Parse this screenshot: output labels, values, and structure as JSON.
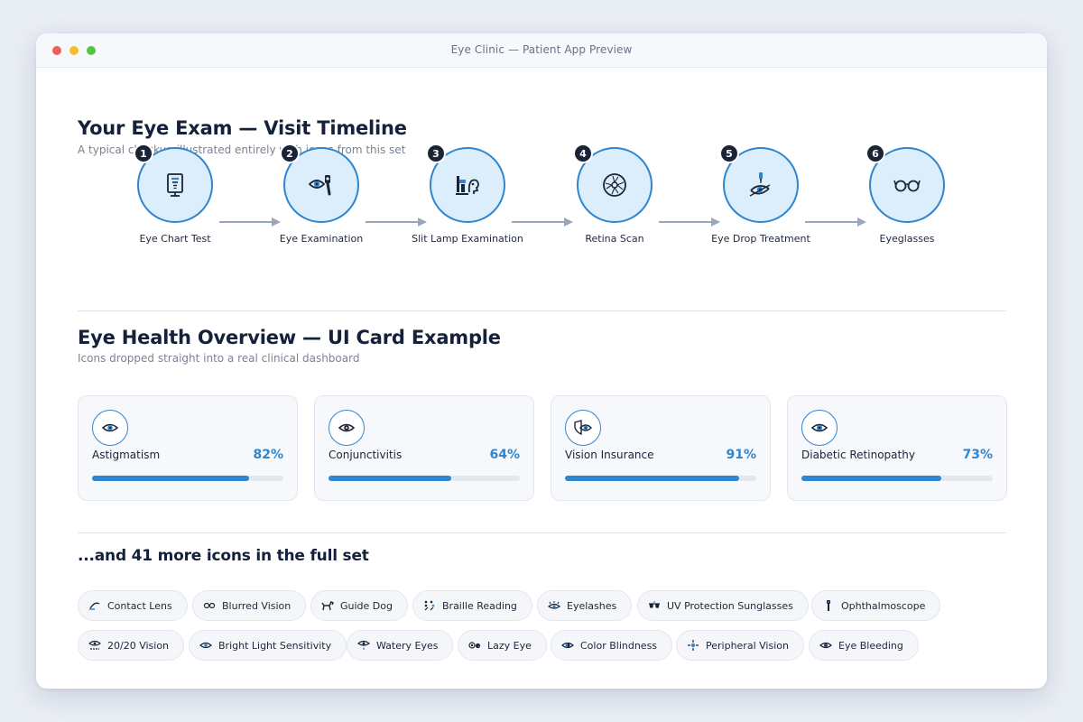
{
  "window": {
    "title": "Eye Clinic — Patient App Preview"
  },
  "timeline": {
    "title": "Your Eye Exam — Visit Timeline",
    "subtitle": "A typical checkup illustrated entirely with icons from this set",
    "steps": [
      {
        "number": "1",
        "label": "Eye Chart Test",
        "icon": "eye-chart-icon"
      },
      {
        "number": "2",
        "label": "Eye Examination",
        "icon": "eye-examination-icon"
      },
      {
        "number": "3",
        "label": "Slit Lamp Examination",
        "icon": "slit-lamp-icon"
      },
      {
        "number": "4",
        "label": "Retina Scan",
        "icon": "retina-scan-icon"
      },
      {
        "number": "5",
        "label": "Eye Drop Treatment",
        "icon": "eye-drop-icon"
      },
      {
        "number": "6",
        "label": "Eyeglasses",
        "icon": "eyeglasses-icon"
      }
    ]
  },
  "overview": {
    "title": "Eye Health Overview — UI Card Example",
    "subtitle": "Icons dropped straight into a real clinical dashboard",
    "cards": [
      {
        "label": "Astigmatism",
        "percent_text": "82%",
        "progress": 0.82,
        "icon": "astigmatism-eye-icon"
      },
      {
        "label": "Conjunctivitis",
        "percent_text": "64%",
        "progress": 0.64,
        "icon": "conjunctivitis-eye-icon"
      },
      {
        "label": "Vision Insurance",
        "percent_text": "91%",
        "progress": 0.91,
        "icon": "vision-insurance-icon"
      },
      {
        "label": "Diabetic Retinopathy",
        "percent_text": "73%",
        "progress": 0.73,
        "icon": "diabetic-retinopathy-icon"
      }
    ]
  },
  "more": {
    "title": "...and 41 more icons in the full set",
    "chips": [
      {
        "label": "Contact Lens",
        "icon": "contact-lens-icon"
      },
      {
        "label": "Blurred Vision",
        "icon": "blurred-vision-icon"
      },
      {
        "label": "Guide Dog",
        "icon": "guide-dog-icon"
      },
      {
        "label": "Braille Reading",
        "icon": "braille-reading-icon"
      },
      {
        "label": "Eyelashes",
        "icon": "eyelashes-icon"
      },
      {
        "label": "UV Protection Sunglasses",
        "icon": "sunglasses-icon"
      },
      {
        "label": "Ophthalmoscope",
        "icon": "ophthalmoscope-icon"
      },
      {
        "label": "20/20 Vision",
        "icon": "vision-2020-icon"
      },
      {
        "label": "Bright Light Sensitivity",
        "icon": "light-sensitivity-icon"
      },
      {
        "label": "Watery Eyes",
        "icon": "watery-eyes-icon"
      },
      {
        "label": "Lazy Eye",
        "icon": "lazy-eye-icon"
      },
      {
        "label": "Color Blindness",
        "icon": "color-blindness-icon"
      },
      {
        "label": "Peripheral Vision",
        "icon": "peripheral-vision-icon"
      },
      {
        "label": "Eye Bleeding",
        "icon": "eye-bleeding-icon"
      }
    ]
  },
  "colors": {
    "accent": "#2f86cf",
    "accent_light": "#dcedfb",
    "dark": "#1b2436",
    "track": "#e3e8ef"
  }
}
